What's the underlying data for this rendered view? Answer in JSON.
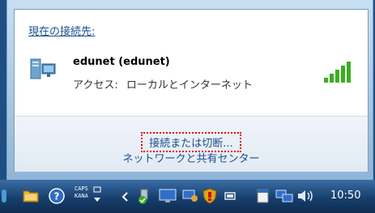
{
  "popup": {
    "header": "現在の接続先:",
    "network_name": "edunet (edunet)",
    "access_label": "アクセス:",
    "access_value": "ローカルとインターネット",
    "connect_link": "接続または切断...",
    "center_link": "ネットワークと共有センター"
  },
  "taskbar": {
    "caps_label": "CAPS",
    "kana_label": "KANA",
    "clock": "10:50",
    "icons": [
      "folder-icon",
      "help-icon",
      "chevron-left-icon",
      "safe-remove-icon",
      "monitor-icon",
      "network-users-icon",
      "security-shield-icon",
      "battery-icon",
      "notepad-icon",
      "network-icon",
      "volume-icon"
    ]
  },
  "colors": {
    "link": "#1c4f8e",
    "highlight_border": "#e00000",
    "signal": "#3cae1f",
    "taskbar": "#173f6d"
  }
}
